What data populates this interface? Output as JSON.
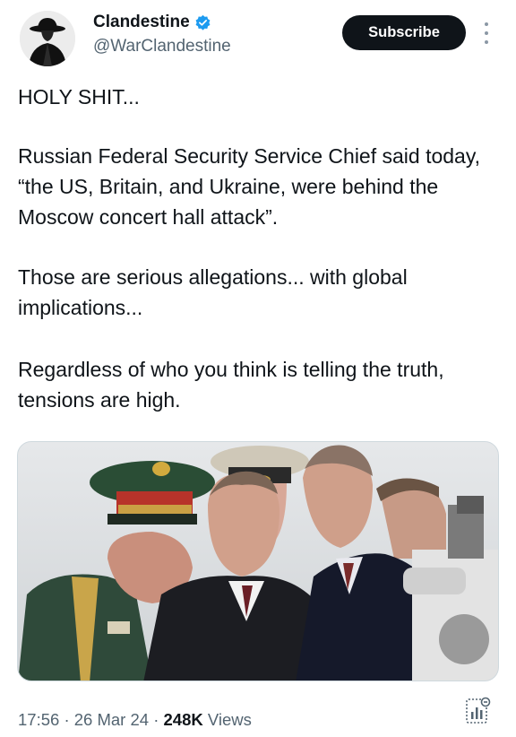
{
  "author": {
    "display_name": "Clandestine",
    "handle": "@WarClandestine",
    "verified": true,
    "verified_color": "#1d9bf0"
  },
  "actions": {
    "subscribe_label": "Subscribe",
    "more_icon": "more-vertical-icon"
  },
  "tweet": {
    "paragraphs": [
      "HOLY SHIT...",
      "Russian Federal Security Service Chief said today, “the US, Britain, and Ukraine, were behind the Moscow concert hall attack”.",
      "Those are serious allegations... with global implications...",
      "Regardless of who you think is telling the truth, tensions are high."
    ]
  },
  "meta": {
    "time": "17:56",
    "date": "26 Mar 24",
    "views_count": "248K",
    "views_label": "Views",
    "separator": "·"
  },
  "colors": {
    "text": "#0f1419",
    "secondary": "#536471",
    "button_bg": "#0f1419"
  }
}
